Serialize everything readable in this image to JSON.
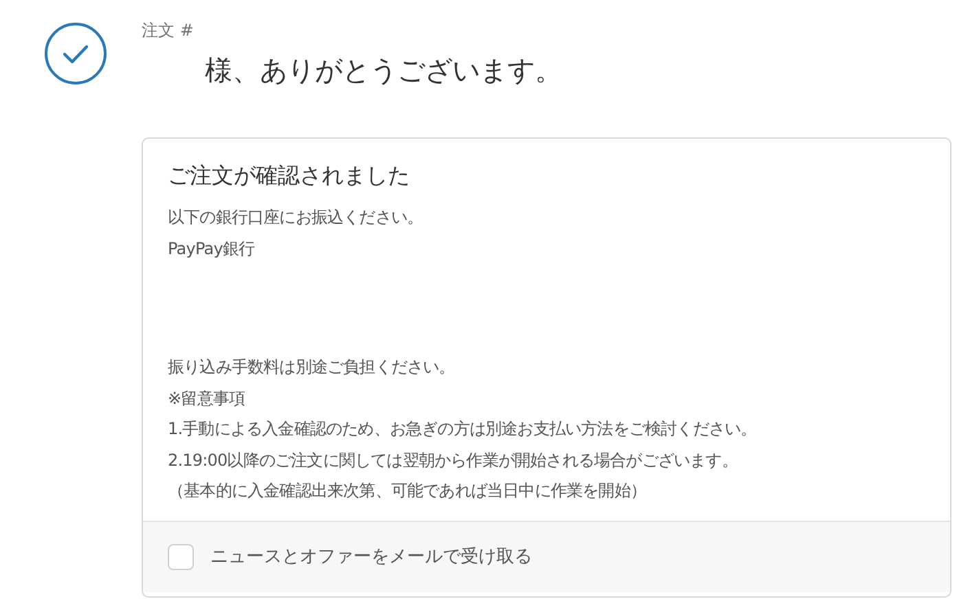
{
  "header": {
    "order_label": "注文 #",
    "title": "様、ありがとうございます。"
  },
  "card": {
    "heading": "ご注文が確認されました",
    "paragraphs": [
      [
        "以下の銀行口座にお振込ください。",
        "PayPay銀行"
      ],
      [
        "振り込み手数料は別途ご負担ください。",
        "※留意事項",
        "1.手動による入金確認のため、お急ぎの方は別途お支払い方法をご検討ください。",
        "2.19:00以降のご注文に関しては翌朝から作業が開始される場合がございます。",
        "（基本的に入金確認出来次第、可能であれば当日中に作業を開始）"
      ]
    ],
    "newsletter": {
      "label": "ニュースとオファーをメールで受け取る",
      "checked": false
    }
  }
}
